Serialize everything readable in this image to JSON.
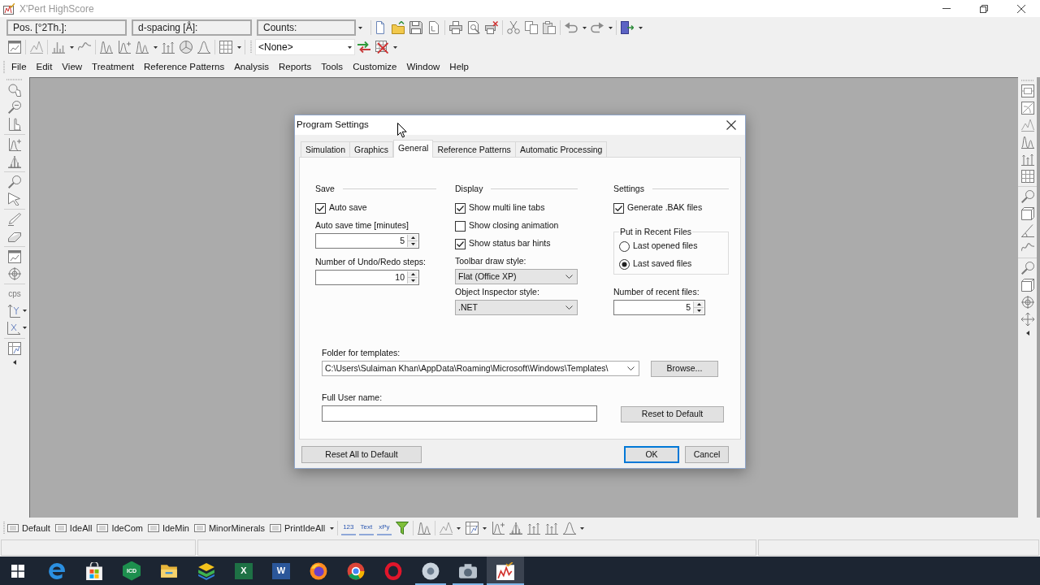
{
  "window": {
    "title": "X'Pert HighScore"
  },
  "readouts": [
    "Pos. [°2Th.]:",
    "d-spacing [Å]:",
    "Counts:"
  ],
  "pattern_selector": {
    "value": "<None>"
  },
  "menu": [
    "File",
    "Edit",
    "View",
    "Treatment",
    "Reference Patterns",
    "Analysis",
    "Reports",
    "Tools",
    "Customize",
    "Window",
    "Help"
  ],
  "left_toolbar": {
    "unit_label": "cps"
  },
  "dialog": {
    "title": "Program Settings",
    "tabs": [
      {
        "label": "Simulation",
        "selected": false
      },
      {
        "label": "Graphics",
        "selected": false
      },
      {
        "label": "General",
        "selected": true
      },
      {
        "label": "Reference Patterns",
        "selected": false
      },
      {
        "label": "Automatic Processing",
        "selected": false
      }
    ],
    "groups": [
      {
        "heading": "Save",
        "items": [
          {
            "kind": "checkbox",
            "label": "Auto save",
            "checked": true
          },
          {
            "kind": "spin",
            "label": "Auto save time [minutes]",
            "value": "5"
          },
          {
            "kind": "spin",
            "label": "Number of Undo/Redo steps:",
            "value": "10"
          }
        ]
      },
      {
        "heading": "Display",
        "items": [
          {
            "kind": "checkbox",
            "label": "Show multi line tabs",
            "checked": true
          },
          {
            "kind": "checkbox",
            "label": "Show closing animation",
            "checked": false
          },
          {
            "kind": "checkbox",
            "label": "Show status bar hints",
            "checked": true
          },
          {
            "kind": "dropdown",
            "label": "Toolbar draw style:",
            "value": "Flat (Office XP)"
          },
          {
            "kind": "dropdown",
            "label": "Object Inspector style:",
            "value": ".NET"
          }
        ]
      },
      {
        "heading": "Settings",
        "items": [
          {
            "kind": "checkbox",
            "label": "Generate .BAK files",
            "checked": true
          },
          {
            "kind": "radio_group",
            "label": "Put in Recent Files",
            "options": [
              {
                "label": "Last opened files",
                "selected": false
              },
              {
                "label": "Last saved files",
                "selected": true
              }
            ]
          },
          {
            "kind": "spin",
            "label": "Number of recent files:",
            "value": "5"
          }
        ]
      }
    ],
    "templates_folder": {
      "label": "Folder for templates:",
      "value": "C:\\Users\\Sulaiman Khan\\AppData\\Roaming\\Microsoft\\Windows\\Templates\\",
      "button": "Browse..."
    },
    "user_name": {
      "label": "Full User name:",
      "button": "Reset to Default"
    },
    "buttons": [
      {
        "label": "Reset All to Default",
        "default": false
      },
      {
        "label": "OK",
        "default": true
      },
      {
        "label": "Cancel",
        "default": false
      }
    ]
  },
  "bottom_toolbar": {
    "layouts": [
      "Default",
      "IdeAll",
      "IdeCom",
      "IdeMin",
      "MinorMinerals",
      "PrintIdeAll"
    ],
    "label_tools": [
      "123",
      "Text",
      "xPy"
    ]
  },
  "taskbar": {
    "apps": [
      {
        "kind": "browser_e",
        "open": false,
        "selected": false
      },
      {
        "kind": "bag",
        "open": false,
        "selected": false
      },
      {
        "kind": "hexagon",
        "logo_text": "ICD",
        "open": false,
        "selected": false
      },
      {
        "kind": "folder",
        "open": false,
        "selected": false
      },
      {
        "kind": "layers",
        "open": false,
        "selected": false
      },
      {
        "kind": "sheet",
        "logo_text": "X",
        "open": false,
        "selected": false
      },
      {
        "kind": "doc",
        "logo_text": "W",
        "open": false,
        "selected": false
      },
      {
        "kind": "fox",
        "open": false,
        "selected": false
      },
      {
        "kind": "wheel",
        "open": false,
        "selected": false
      },
      {
        "kind": "ring",
        "open": false,
        "selected": false
      },
      {
        "kind": "disc",
        "open": true,
        "selected": false
      },
      {
        "kind": "camera",
        "open": true,
        "selected": false
      },
      {
        "kind": "chart",
        "open": true,
        "selected": true
      }
    ]
  }
}
